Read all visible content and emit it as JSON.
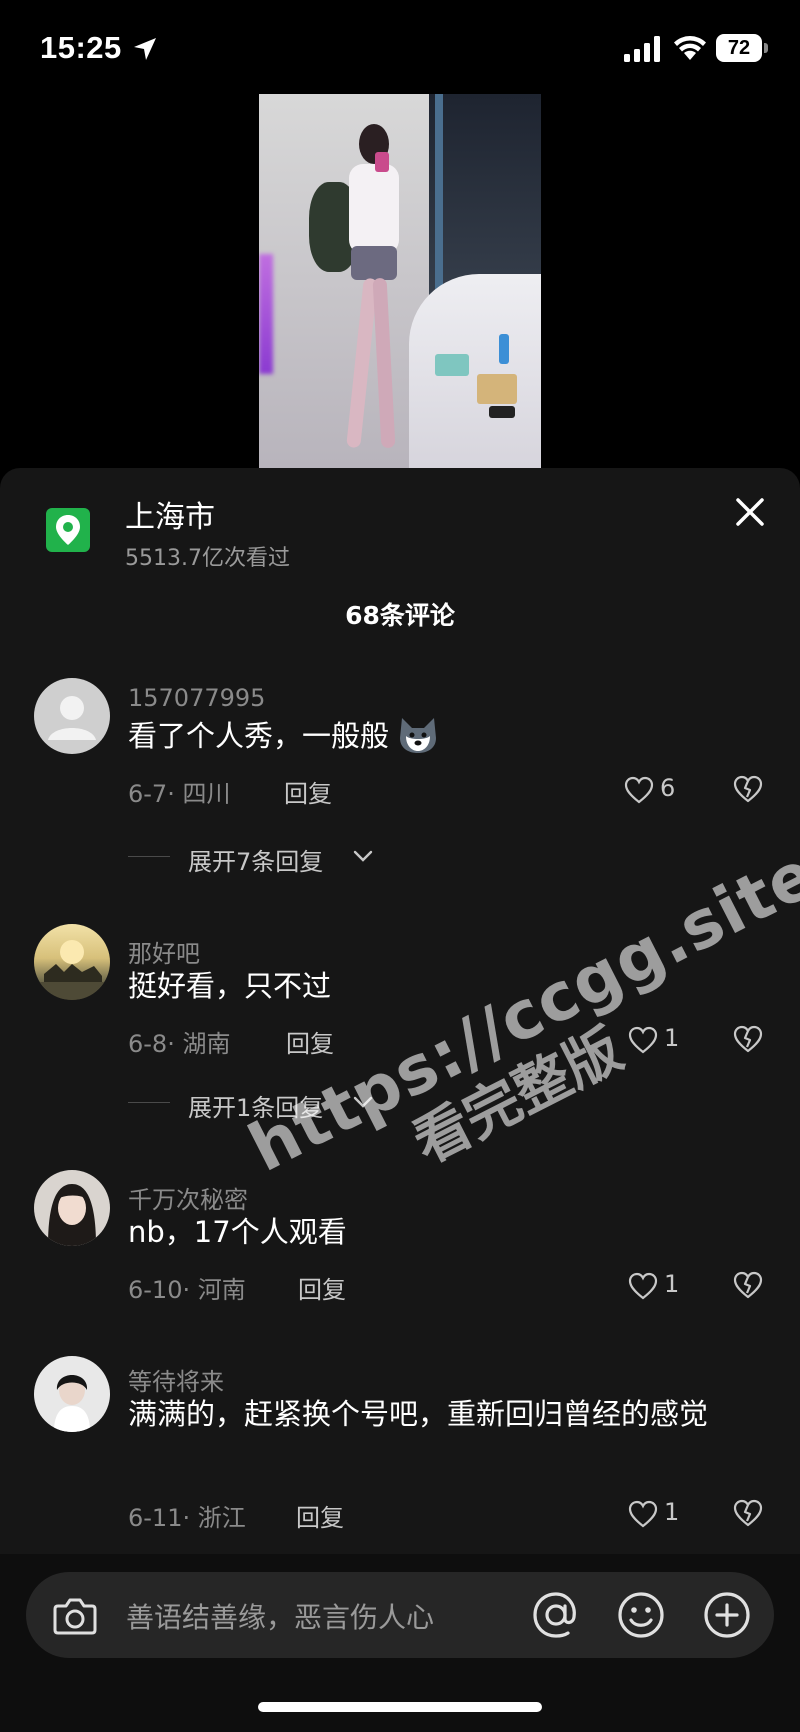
{
  "status_bar": {
    "time": "15:25",
    "battery": "72"
  },
  "location": {
    "name": "上海市",
    "views": "5513.7亿次看过"
  },
  "comment_count": "68条评论",
  "comments": [
    {
      "username": "157077995",
      "text": "看了个人秀，一般般",
      "date_region": "6-7· 四川",
      "reply_label": "回复",
      "likes": "6",
      "expand_label": "展开7条回复"
    },
    {
      "username": "那好吧",
      "text": "挺好看，只不过",
      "date_region": "6-8· 湖南",
      "reply_label": "回复",
      "likes": "1",
      "expand_label": "展开1条回复"
    },
    {
      "username": "千万次秘密",
      "text": "nb，17个人观看",
      "date_region": "6-10· 河南",
      "reply_label": "回复",
      "likes": "1"
    },
    {
      "username": "等待将来",
      "text": "满满的，赶紧换个号吧，重新回归曾经的感觉",
      "date_region": "6-11· 浙江",
      "reply_label": "回复",
      "likes": "1"
    }
  ],
  "watermark": {
    "url": "https://ccgg.site",
    "subtitle": "看完整版"
  },
  "input": {
    "placeholder": "善语结善缘，恶言伤人心"
  },
  "colors": {
    "accent_green": "#21b24b",
    "sheet_bg": "#161616"
  }
}
